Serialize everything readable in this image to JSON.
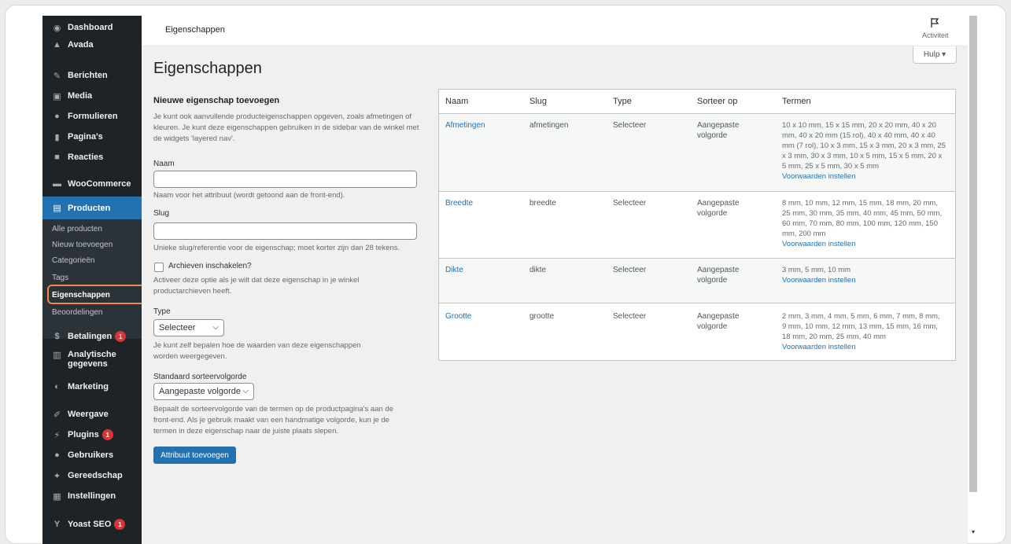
{
  "topbar": {
    "title": "Eigenschappen",
    "activity_label": "Activiteit",
    "help_label": "Hulp ▾"
  },
  "sidebar": {
    "items": [
      {
        "label": "Dashboard",
        "icon": "dashboard-icon"
      },
      {
        "label": "Avada",
        "icon": "avada-icon"
      },
      {
        "label": "Berichten",
        "icon": "pin-icon"
      },
      {
        "label": "Media",
        "icon": "media-icon"
      },
      {
        "label": "Formulieren",
        "icon": "forms-icon"
      },
      {
        "label": "Pagina's",
        "icon": "pages-icon"
      },
      {
        "label": "Reacties",
        "icon": "comments-icon"
      },
      {
        "label": "WooCommerce",
        "icon": "woocommerce-icon"
      },
      {
        "label": "Producten",
        "icon": "products-icon"
      },
      {
        "label": "Betalingen",
        "icon": "payments-icon",
        "badge": "1"
      },
      {
        "label": "Analytische gegevens",
        "icon": "analytics-icon"
      },
      {
        "label": "Marketing",
        "icon": "marketing-icon"
      },
      {
        "label": "Weergave",
        "icon": "appearance-icon"
      },
      {
        "label": "Plugins",
        "icon": "plugins-icon",
        "badge": "1"
      },
      {
        "label": "Gebruikers",
        "icon": "users-icon"
      },
      {
        "label": "Gereedschap",
        "icon": "tools-icon"
      },
      {
        "label": "Instellingen",
        "icon": "settings-icon"
      },
      {
        "label": "Yoast SEO",
        "icon": "yoast-icon",
        "badge": "1"
      }
    ],
    "submenu": [
      "Alle producten",
      "Nieuw toevoegen",
      "Categorieën",
      "Tags",
      "Eigenschappen",
      "Beoordelingen"
    ],
    "analytics_line1": "Analytische",
    "analytics_line2": "gegevens"
  },
  "page": {
    "heading": "Eigenschappen",
    "form_title": "Nieuwe eigenschap toevoegen",
    "intro_lines": [
      "Je kunt ook aanvullende producteigenschappen opgeven, zoals afmetingen of",
      "kleuren. Je kunt deze eigenschappen gebruiken in de sidebar van de winkel met",
      "de widgets 'layered nav'."
    ],
    "name_label": "Naam",
    "name_value": "",
    "name_help": "Naam voor het attribuut (wordt getoond aan de front-end).",
    "slug_label": "Slug",
    "slug_value": "",
    "slug_help": "Unieke slug/referentie voor de eigenschap; moet korter zijn dan 28 tekens.",
    "archive_label": "Archieven inschakelen?",
    "archive_help_lines": [
      "Activeer deze optie als je wilt dat deze eigenschap in je winkel",
      "productarchieven heeft."
    ],
    "type_label": "Type",
    "type_value": "Selecteer",
    "type_help_lines": [
      "Je kunt zelf bepalen hoe de waarden van deze eigenschappen",
      "worden weergegeven."
    ],
    "sort_label": "Standaard sorteervolgorde",
    "sort_value": "Aangepaste volgorde",
    "sort_help_lines": [
      "Bepaalt de sorteervolgorde van de termen op de productpagina's aan de",
      "front-end. Als je gebruik maakt van een handmatige volgorde, kun je de",
      "termen in deze eigenschap naar de juiste plaats slepen."
    ],
    "submit_label": "Attribuut toevoegen"
  },
  "table": {
    "headers": [
      "Naam",
      "Slug",
      "Type",
      "Sorteer op",
      "Termen"
    ],
    "configure_label": "Voorwaarden instellen",
    "rows": [
      {
        "name": "Afmetingen",
        "slug": "afmetingen",
        "type": "Selecteer",
        "sort_line1": "Aangepaste",
        "sort_line2": "volgorde",
        "terms_lines": [
          "10 x 10 mm, 15 x 15 mm, 20 x 20 mm, 40 x 20",
          "mm, 40 x 20 mm (15 rol), 40 x 40 mm, 40 x 40",
          "mm (7 rol), 10 x 3 mm, 15 x 3 mm, 20 x 3 mm, 25",
          "x 3 mm, 30 x 3 mm, 10 x 5 mm, 15 x 5 mm, 20 x",
          "5 mm, 25 x 5 mm, 30 x 5 mm"
        ]
      },
      {
        "name": "Breedte",
        "slug": "breedte",
        "type": "Selecteer",
        "sort_line1": "Aangepaste",
        "sort_line2": "volgorde",
        "terms_lines": [
          "8 mm, 10 mm, 12 mm, 15 mm, 18 mm, 20 mm,",
          "25 mm, 30 mm, 35 mm, 40 mm, 45 mm, 50 mm,",
          "60 mm, 70 mm, 80 mm, 100 mm, 120 mm, 150",
          "mm, 200 mm"
        ]
      },
      {
        "name": "Dikte",
        "slug": "dikte",
        "type": "Selecteer",
        "sort_line1": "Aangepaste",
        "sort_line2": "volgorde",
        "terms_lines": [
          "3 mm, 5 mm, 10 mm"
        ]
      },
      {
        "name": "Grootte",
        "slug": "grootte",
        "type": "Selecteer",
        "sort_line1": "Aangepaste",
        "sort_line2": "volgorde",
        "terms_lines": [
          "2 mm, 3 mm, 4 mm, 5 mm, 6 mm, 7 mm, 8 mm,",
          "9 mm, 10 mm, 12 mm, 13 mm, 15 mm, 16 mm,",
          "18 mm, 20 mm, 25 mm, 40 mm"
        ]
      }
    ]
  }
}
